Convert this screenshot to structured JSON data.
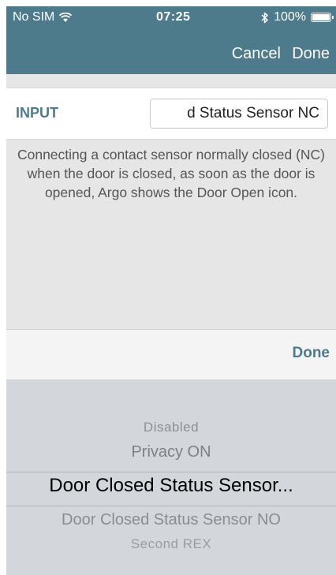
{
  "status_bar": {
    "carrier": "No SIM",
    "wifi_icon": "wifi-icon",
    "time": "07:25",
    "bluetooth_icon": "bluetooth-icon",
    "battery_text": "100%",
    "battery_level": 1.0
  },
  "nav": {
    "cancel_label": "Cancel",
    "done_label": "Done"
  },
  "input": {
    "label": "INPUT",
    "value": "d Status Sensor NC"
  },
  "description": "Connecting a contact sensor normally closed (NC) when the door is closed, as soon as the door is opened, Argo shows the Door Open icon.",
  "picker": {
    "done_label": "Done",
    "options": [
      "Disabled",
      "Privacy ON",
      "Door Closed Status Sensor...",
      "Door Closed Status Sensor NO",
      "Second REX"
    ],
    "selected": "Door Closed Status Sensor..."
  },
  "colors": {
    "accent": "#4e7b8c",
    "background": "#e6e6e6",
    "picker_bg": "#d3d7dc"
  }
}
